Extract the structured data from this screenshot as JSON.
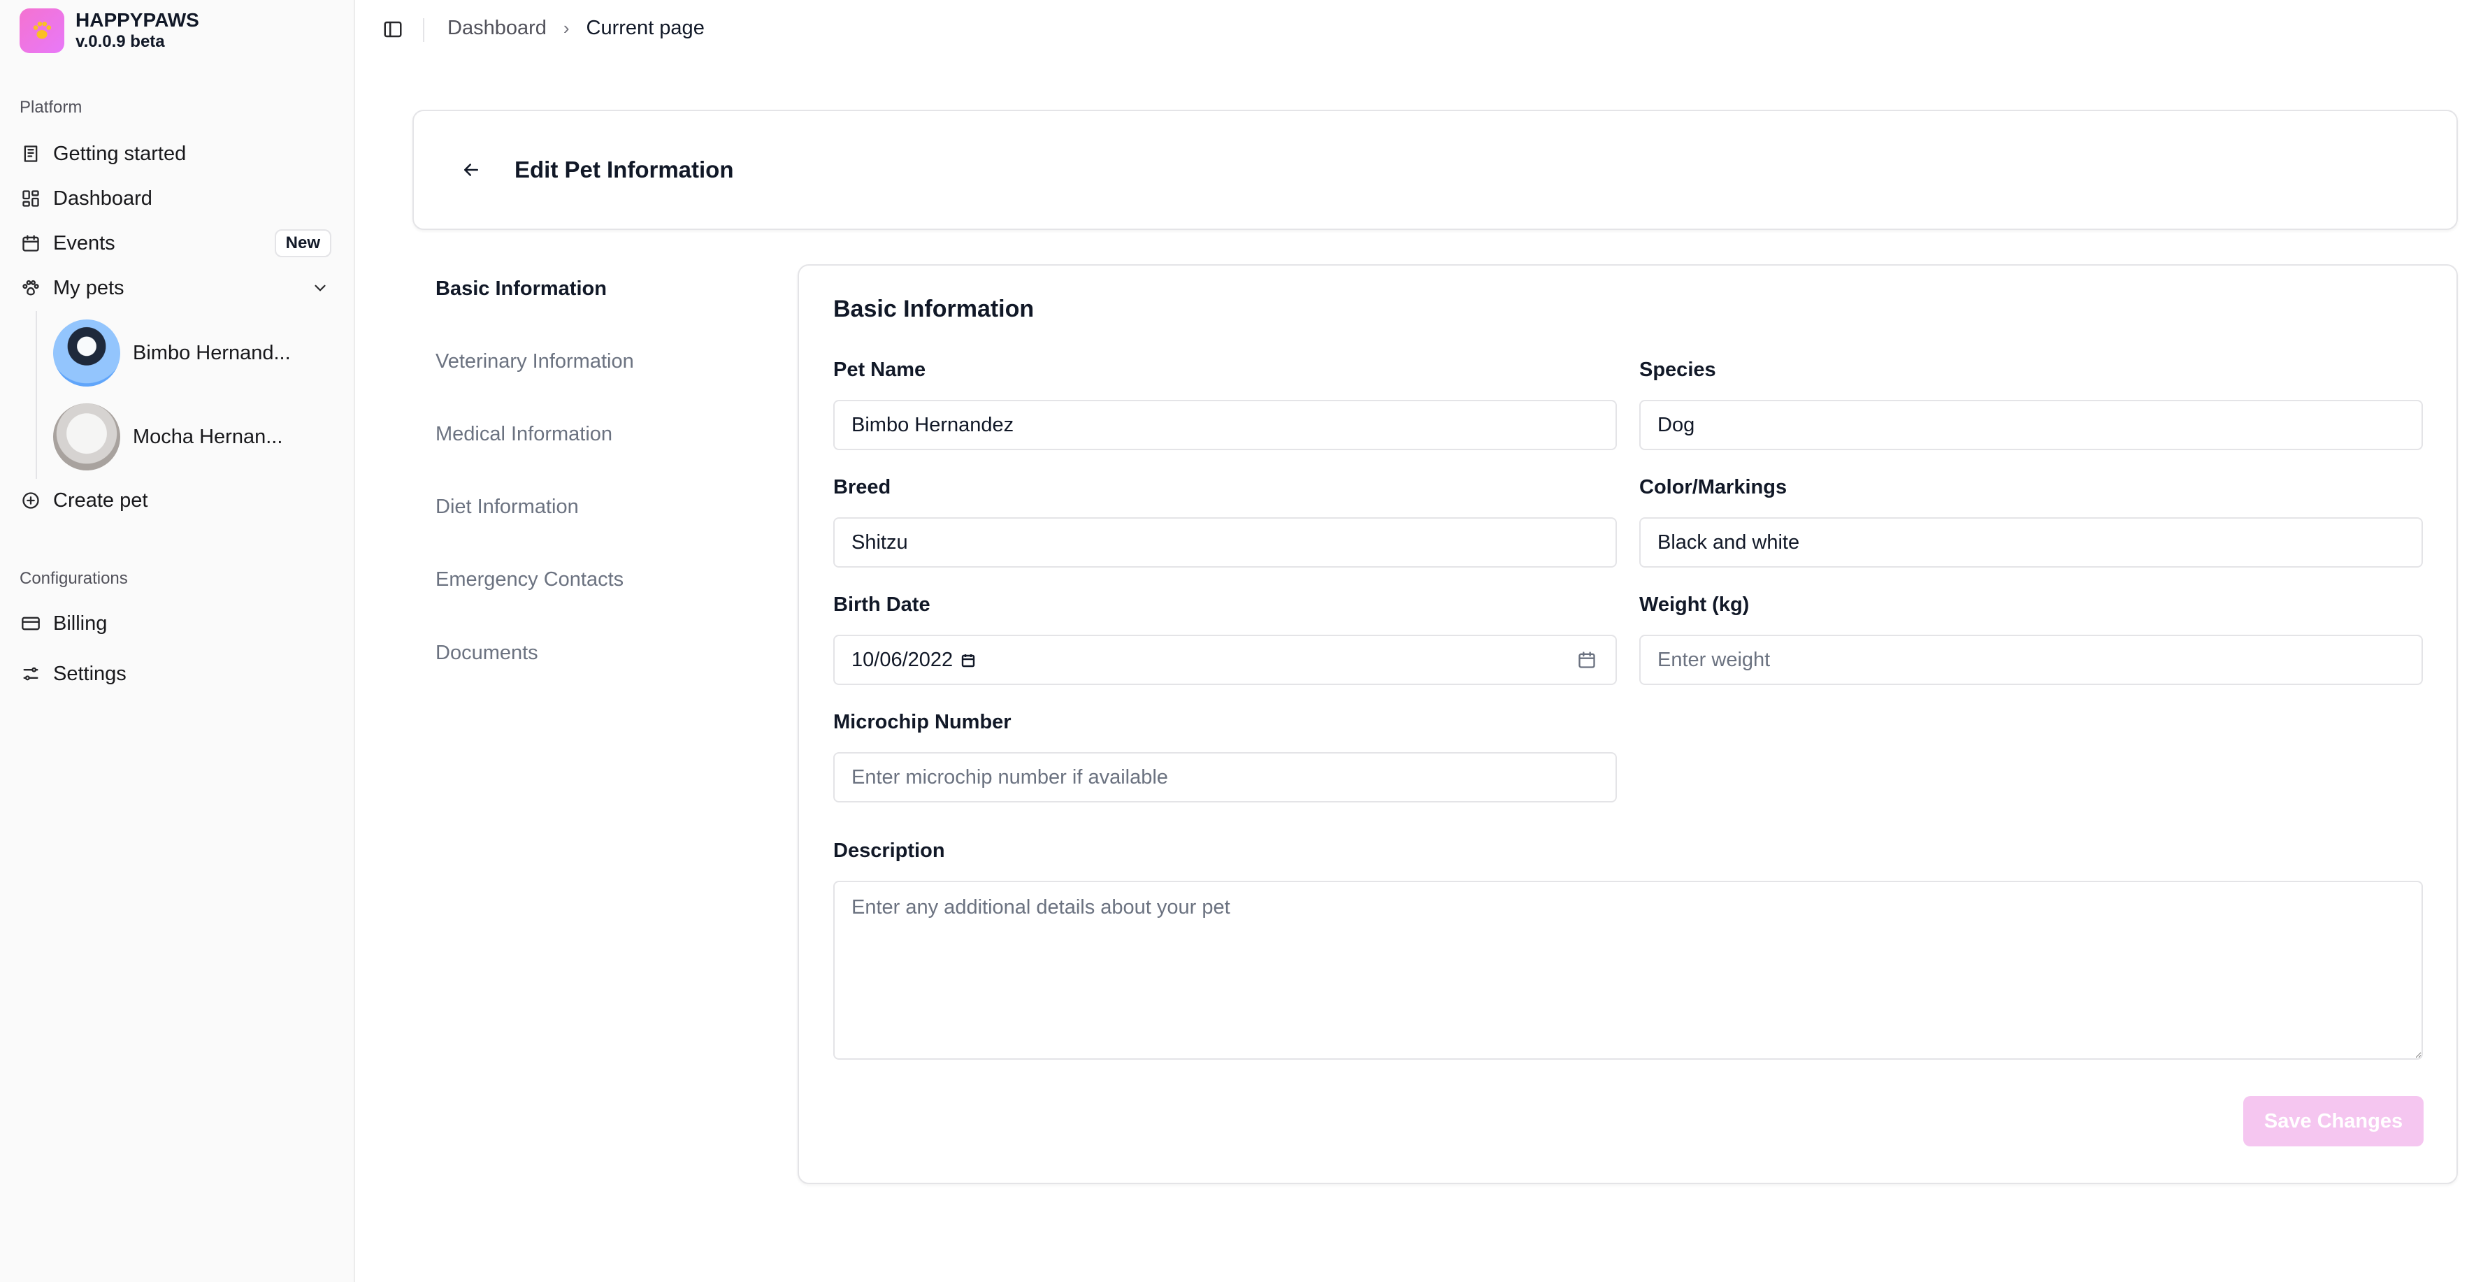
{
  "app": {
    "name": "HAPPYPAWS",
    "version": "v.0.0.9 beta"
  },
  "sidebar": {
    "platform_label": "Platform",
    "items": [
      {
        "label": "Getting started",
        "icon": "book-icon"
      },
      {
        "label": "Dashboard",
        "icon": "dashboard-icon"
      },
      {
        "label": "Events",
        "icon": "calendar-icon",
        "badge": "New"
      },
      {
        "label": "My pets",
        "icon": "paw-icon"
      }
    ],
    "pets": [
      {
        "name": "Bimbo Hernand..."
      },
      {
        "name": "Mocha Hernan..."
      }
    ],
    "create_pet": "Create pet",
    "config_label": "Configurations",
    "config_items": [
      {
        "label": "Billing",
        "icon": "credit-card-icon"
      },
      {
        "label": "Settings",
        "icon": "settings-sliders-icon"
      }
    ]
  },
  "breadcrumb": {
    "root": "Dashboard",
    "current": "Current page"
  },
  "header": {
    "title": "Edit Pet Information"
  },
  "tabs": [
    "Basic Information",
    "Veterinary Information",
    "Medical Information",
    "Diet Information",
    "Emergency Contacts",
    "Documents"
  ],
  "form": {
    "title": "Basic Information",
    "pet_name": {
      "label": "Pet Name",
      "value": "Bimbo Hernandez"
    },
    "species": {
      "label": "Species",
      "value": "Dog"
    },
    "breed": {
      "label": "Breed",
      "value": "Shitzu"
    },
    "color": {
      "label": "Color/Markings",
      "value": "Black and white"
    },
    "birth_date": {
      "label": "Birth Date",
      "value": "10/06/2022"
    },
    "weight": {
      "label": "Weight (kg)",
      "value": "",
      "placeholder": "Enter weight"
    },
    "microchip": {
      "label": "Microchip Number",
      "value": "",
      "placeholder": "Enter microchip number if available"
    },
    "description": {
      "label": "Description",
      "value": "",
      "placeholder": "Enter any additional details about your pet"
    },
    "save_label": "Save Changes"
  },
  "colors": {
    "accent": "#e879f9",
    "save_disabled": "#f5c6f0",
    "border": "#e4e4e7"
  }
}
